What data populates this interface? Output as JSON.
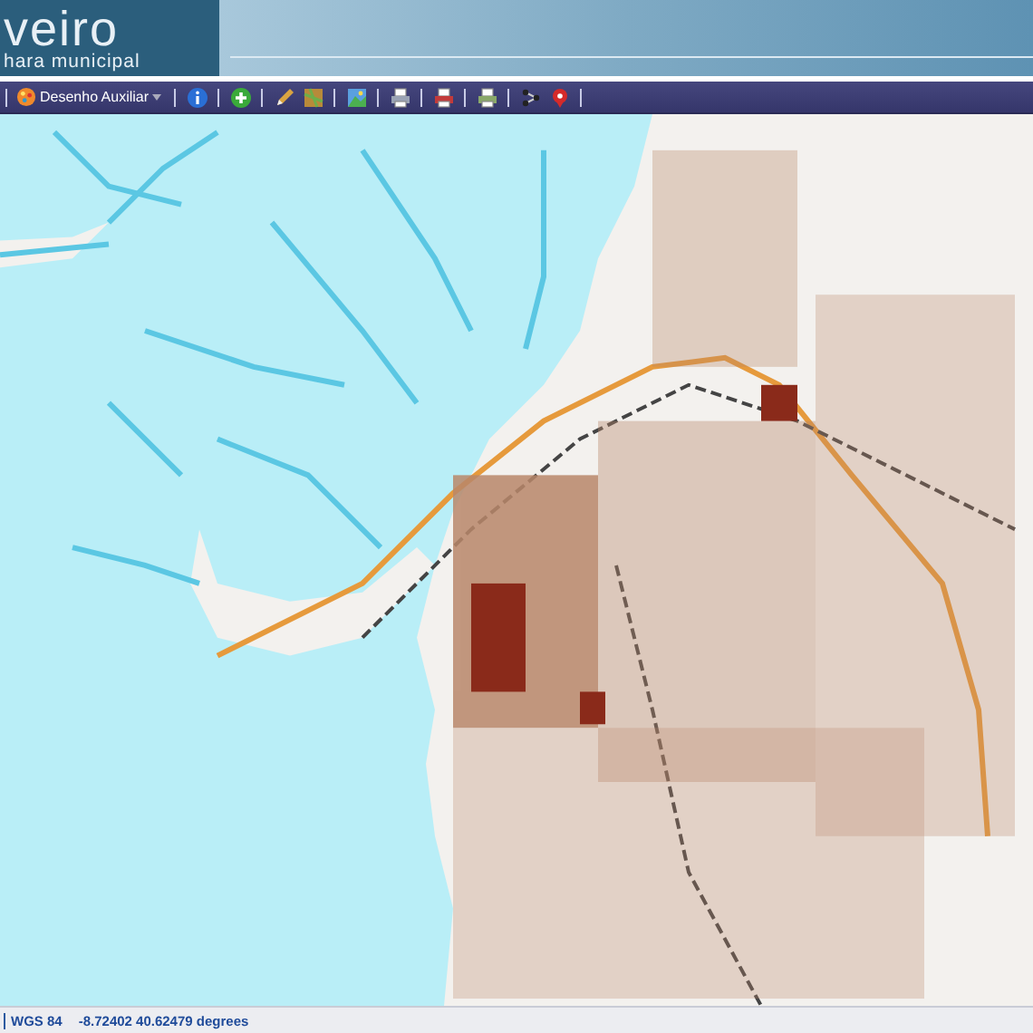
{
  "header": {
    "logo_title": "veiro",
    "logo_subtitle": "hara municipal"
  },
  "toolbar": {
    "dropdown_label": "Desenho Auxiliar"
  },
  "status_bar": {
    "projection": "WGS 84",
    "coordinates": "-8.72402 40.62479 degrees"
  }
}
